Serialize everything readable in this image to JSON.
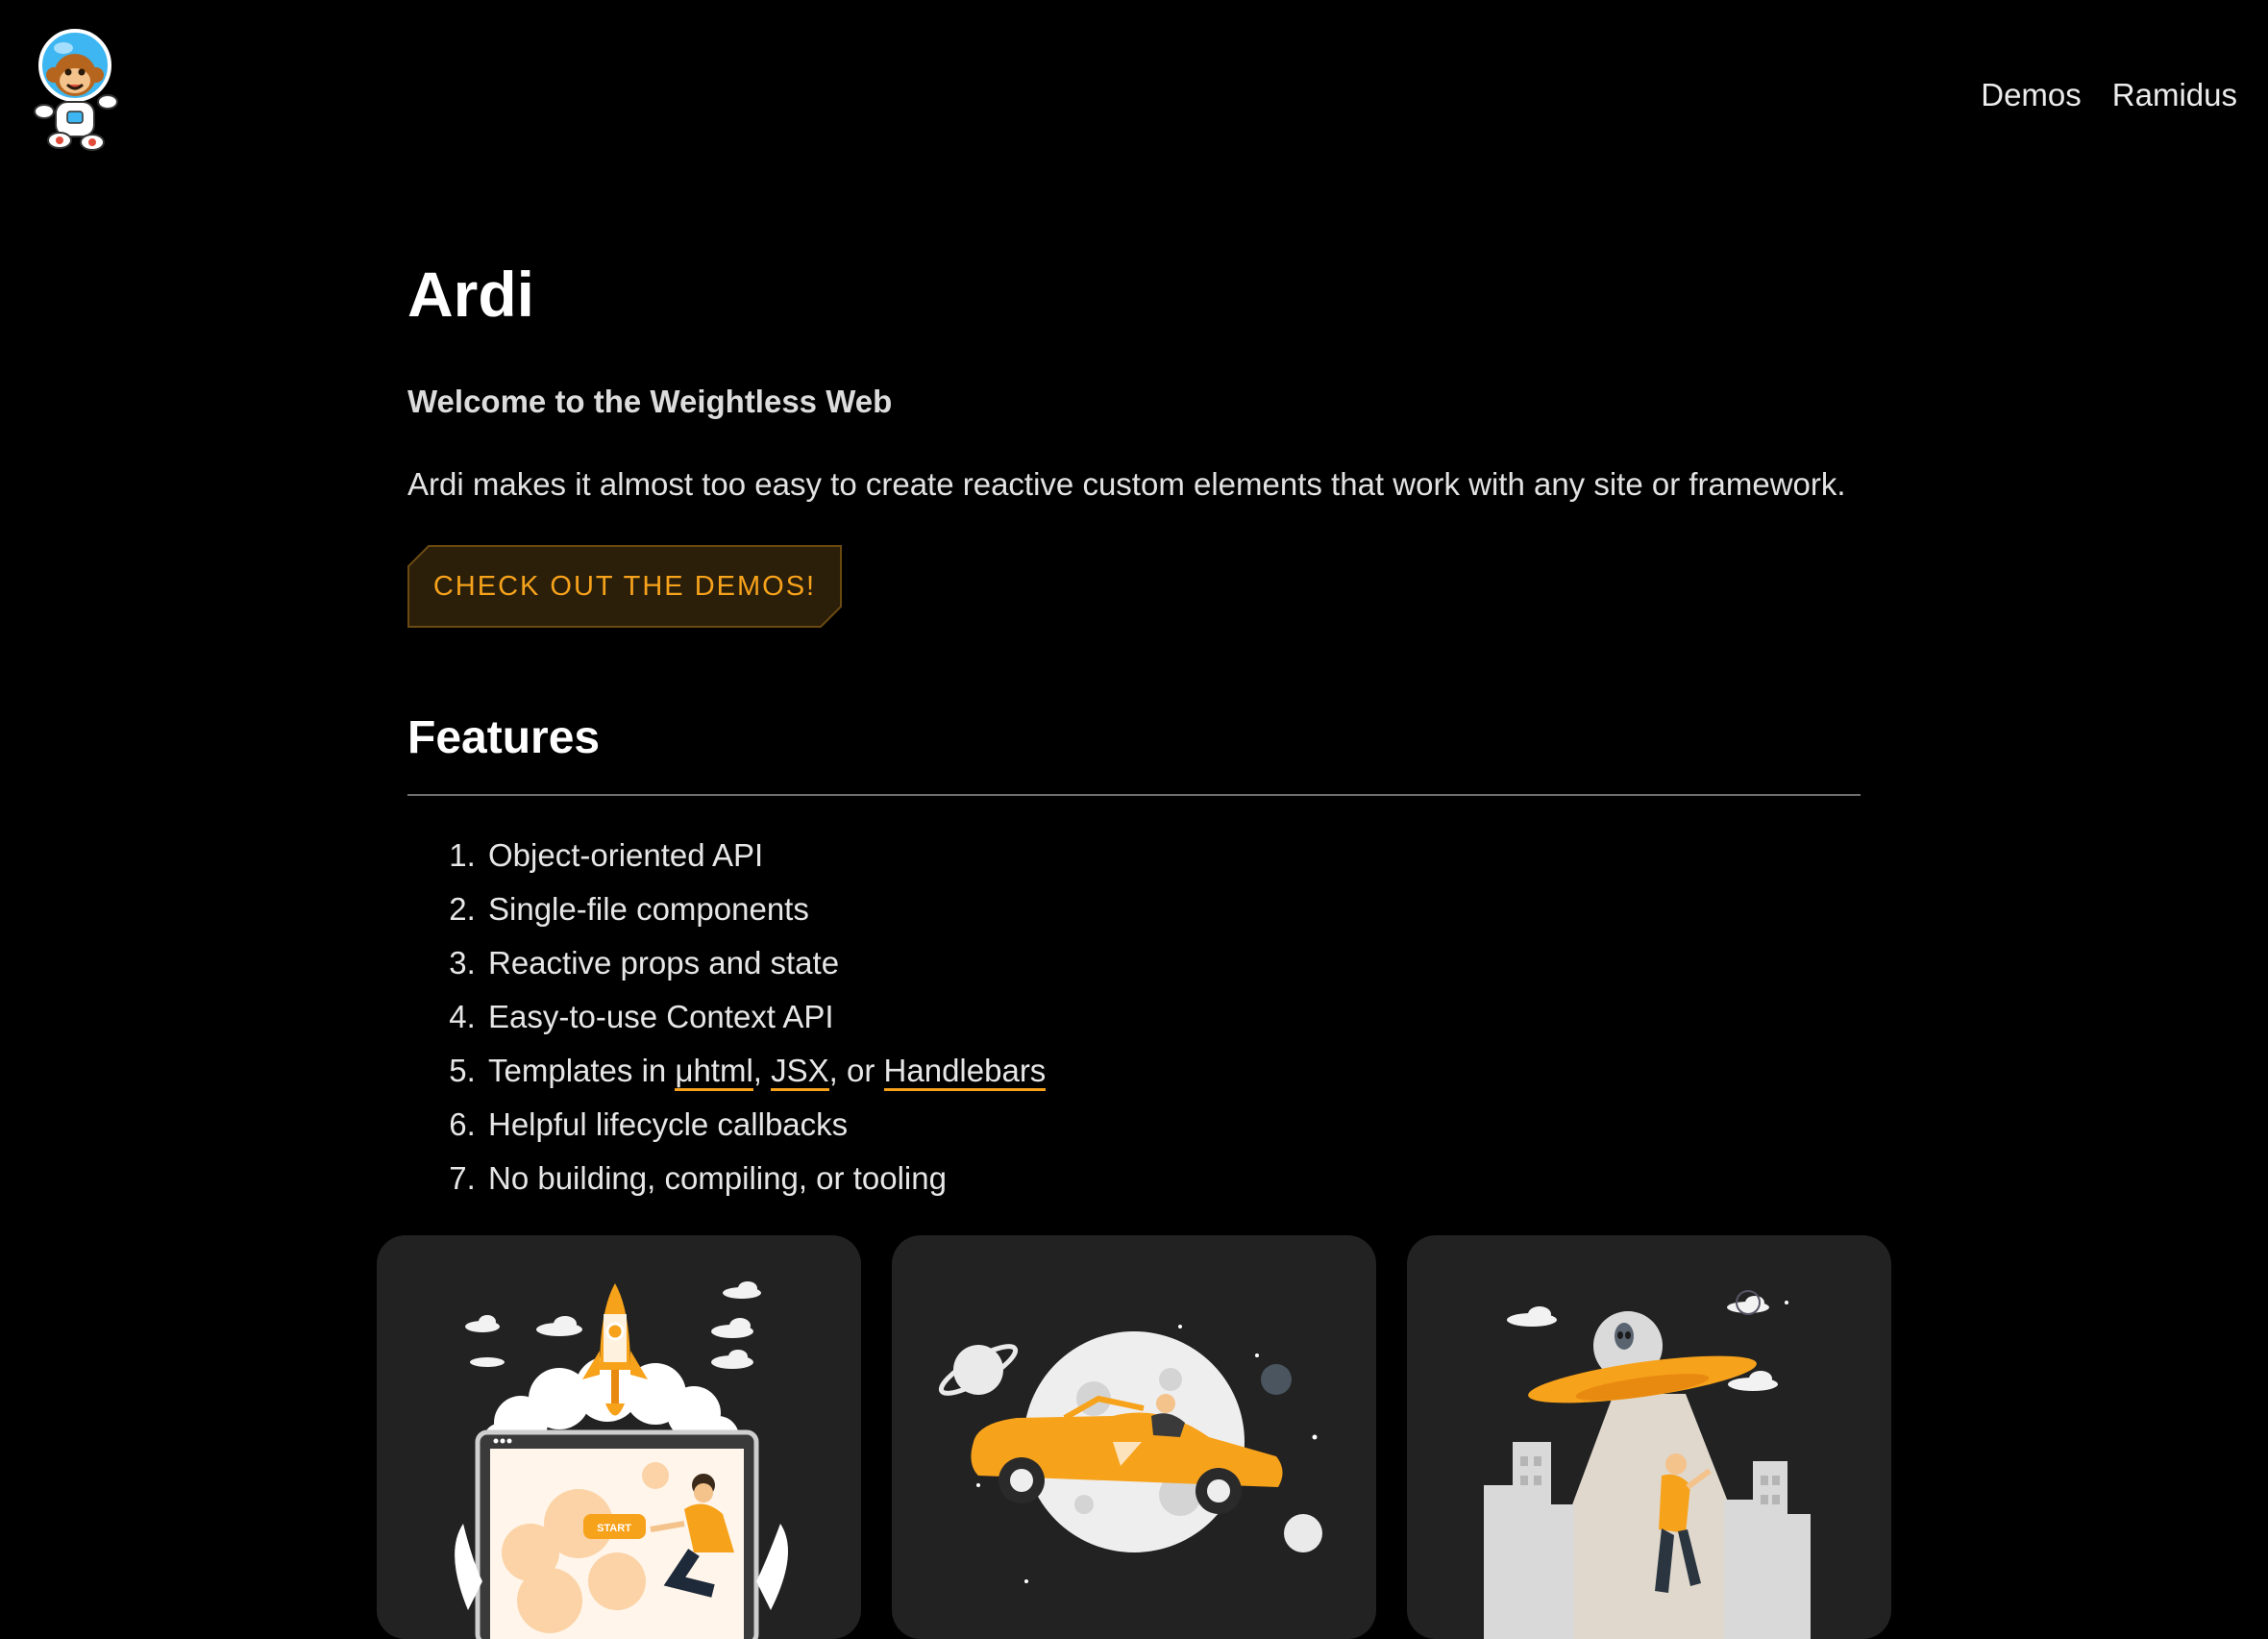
{
  "header": {
    "nav": [
      {
        "label": "Demos"
      },
      {
        "label": "Ramidus"
      }
    ]
  },
  "main": {
    "title": "Ardi",
    "tagline": "Welcome to the Weightless Web",
    "intro": "Ardi makes it almost too easy to create reactive custom elements that work with any site or framework.",
    "cta_label": "CHECK OUT THE DEMOS!",
    "features_heading": "Features",
    "features": [
      "Object-oriented API",
      "Single-file components",
      "Reactive props and state",
      "Easy-to-use Context API",
      "Templates in ",
      "Helpful lifecycle callbacks",
      "No building, compiling, or tooling"
    ],
    "template_links": [
      "μhtml",
      "JSX",
      "Handlebars"
    ],
    "template_separators": [
      ", ",
      ", or "
    ],
    "card_start_label": "START"
  },
  "colors": {
    "background": "#000000",
    "accent": "#f7a21b",
    "card": "#222222"
  },
  "icons": [
    "astronaut-monkey-logo",
    "rocket-launch-illustration",
    "car-in-space-illustration",
    "ufo-abduction-illustration"
  ]
}
